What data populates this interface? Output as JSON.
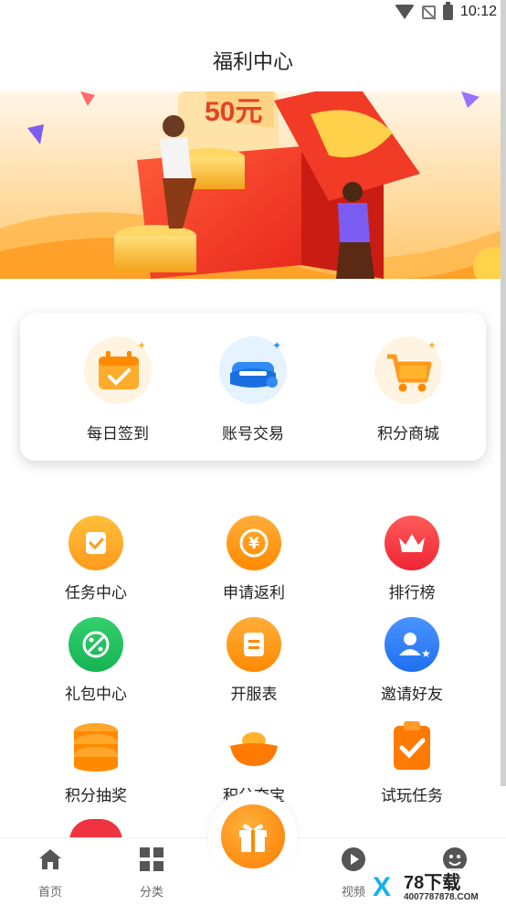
{
  "status_bar": {
    "time": "10:12"
  },
  "page_title": "福利中心",
  "banner": {
    "price_text": "50元"
  },
  "quick_actions": [
    {
      "label": "每日签到",
      "icon": "calendar-check-icon"
    },
    {
      "label": "账号交易",
      "icon": "account-trade-icon"
    },
    {
      "label": "积分商城",
      "icon": "shopping-cart-icon"
    }
  ],
  "grid": [
    {
      "label": "任务中心",
      "icon": "task-check-icon",
      "color": "#ff9a1e"
    },
    {
      "label": "申请返利",
      "icon": "yen-coin-icon",
      "color": "#ff8a00"
    },
    {
      "label": "排行榜",
      "icon": "crown-icon",
      "color": "#f5333f"
    },
    {
      "label": "礼包中心",
      "icon": "gift-tag-icon",
      "color": "#22c55e"
    },
    {
      "label": "开服表",
      "icon": "schedule-icon",
      "color": "#ff8a00"
    },
    {
      "label": "邀请好友",
      "icon": "invite-user-icon",
      "color": "#2f7cf6"
    },
    {
      "label": "积分抽奖",
      "icon": "coin-stack-icon",
      "color": "#ff8a00"
    },
    {
      "label": "积分夺宝",
      "icon": "gold-ingot-icon",
      "color": "#ff7a00"
    },
    {
      "label": "试玩任务",
      "icon": "clipboard-check-icon",
      "color": "#ff7a00"
    }
  ],
  "bottom_nav": [
    {
      "label": "首页",
      "icon": "home-icon"
    },
    {
      "label": "分类",
      "icon": "grid-icon"
    },
    {
      "label": "",
      "icon": "gift-icon"
    },
    {
      "label": "视频",
      "icon": "play-icon"
    },
    {
      "label": "",
      "icon": "smile-icon"
    }
  ],
  "watermark": {
    "brand": "78下载",
    "url": "4007787878.COM"
  }
}
